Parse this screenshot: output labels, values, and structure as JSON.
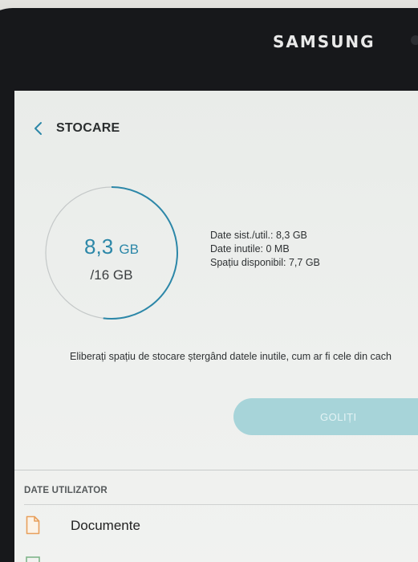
{
  "device": {
    "brand": "SAMSUNG"
  },
  "header": {
    "title": "STOCARE"
  },
  "storage": {
    "used_number": "8,3",
    "used_unit": "GB",
    "total": "/16 GB",
    "used_fraction": 0.52
  },
  "details": {
    "system_user": "Date sist./util.: 8,3 GB",
    "unnecessary": "Date inutile: 0 MB",
    "available": "Spațiu disponibil: 7,7 GB"
  },
  "hint": "Eliberați spațiu de stocare ștergând datele inutile, cum ar fi cele din cach",
  "clean_button": {
    "label": "GOLIȚI"
  },
  "user_data": {
    "section_title": "DATE UTILIZATOR",
    "items": [
      {
        "label": "Documente",
        "icon": "document-icon"
      }
    ]
  },
  "colors": {
    "accent": "#2c87a8",
    "button": "#a7d4d9"
  }
}
